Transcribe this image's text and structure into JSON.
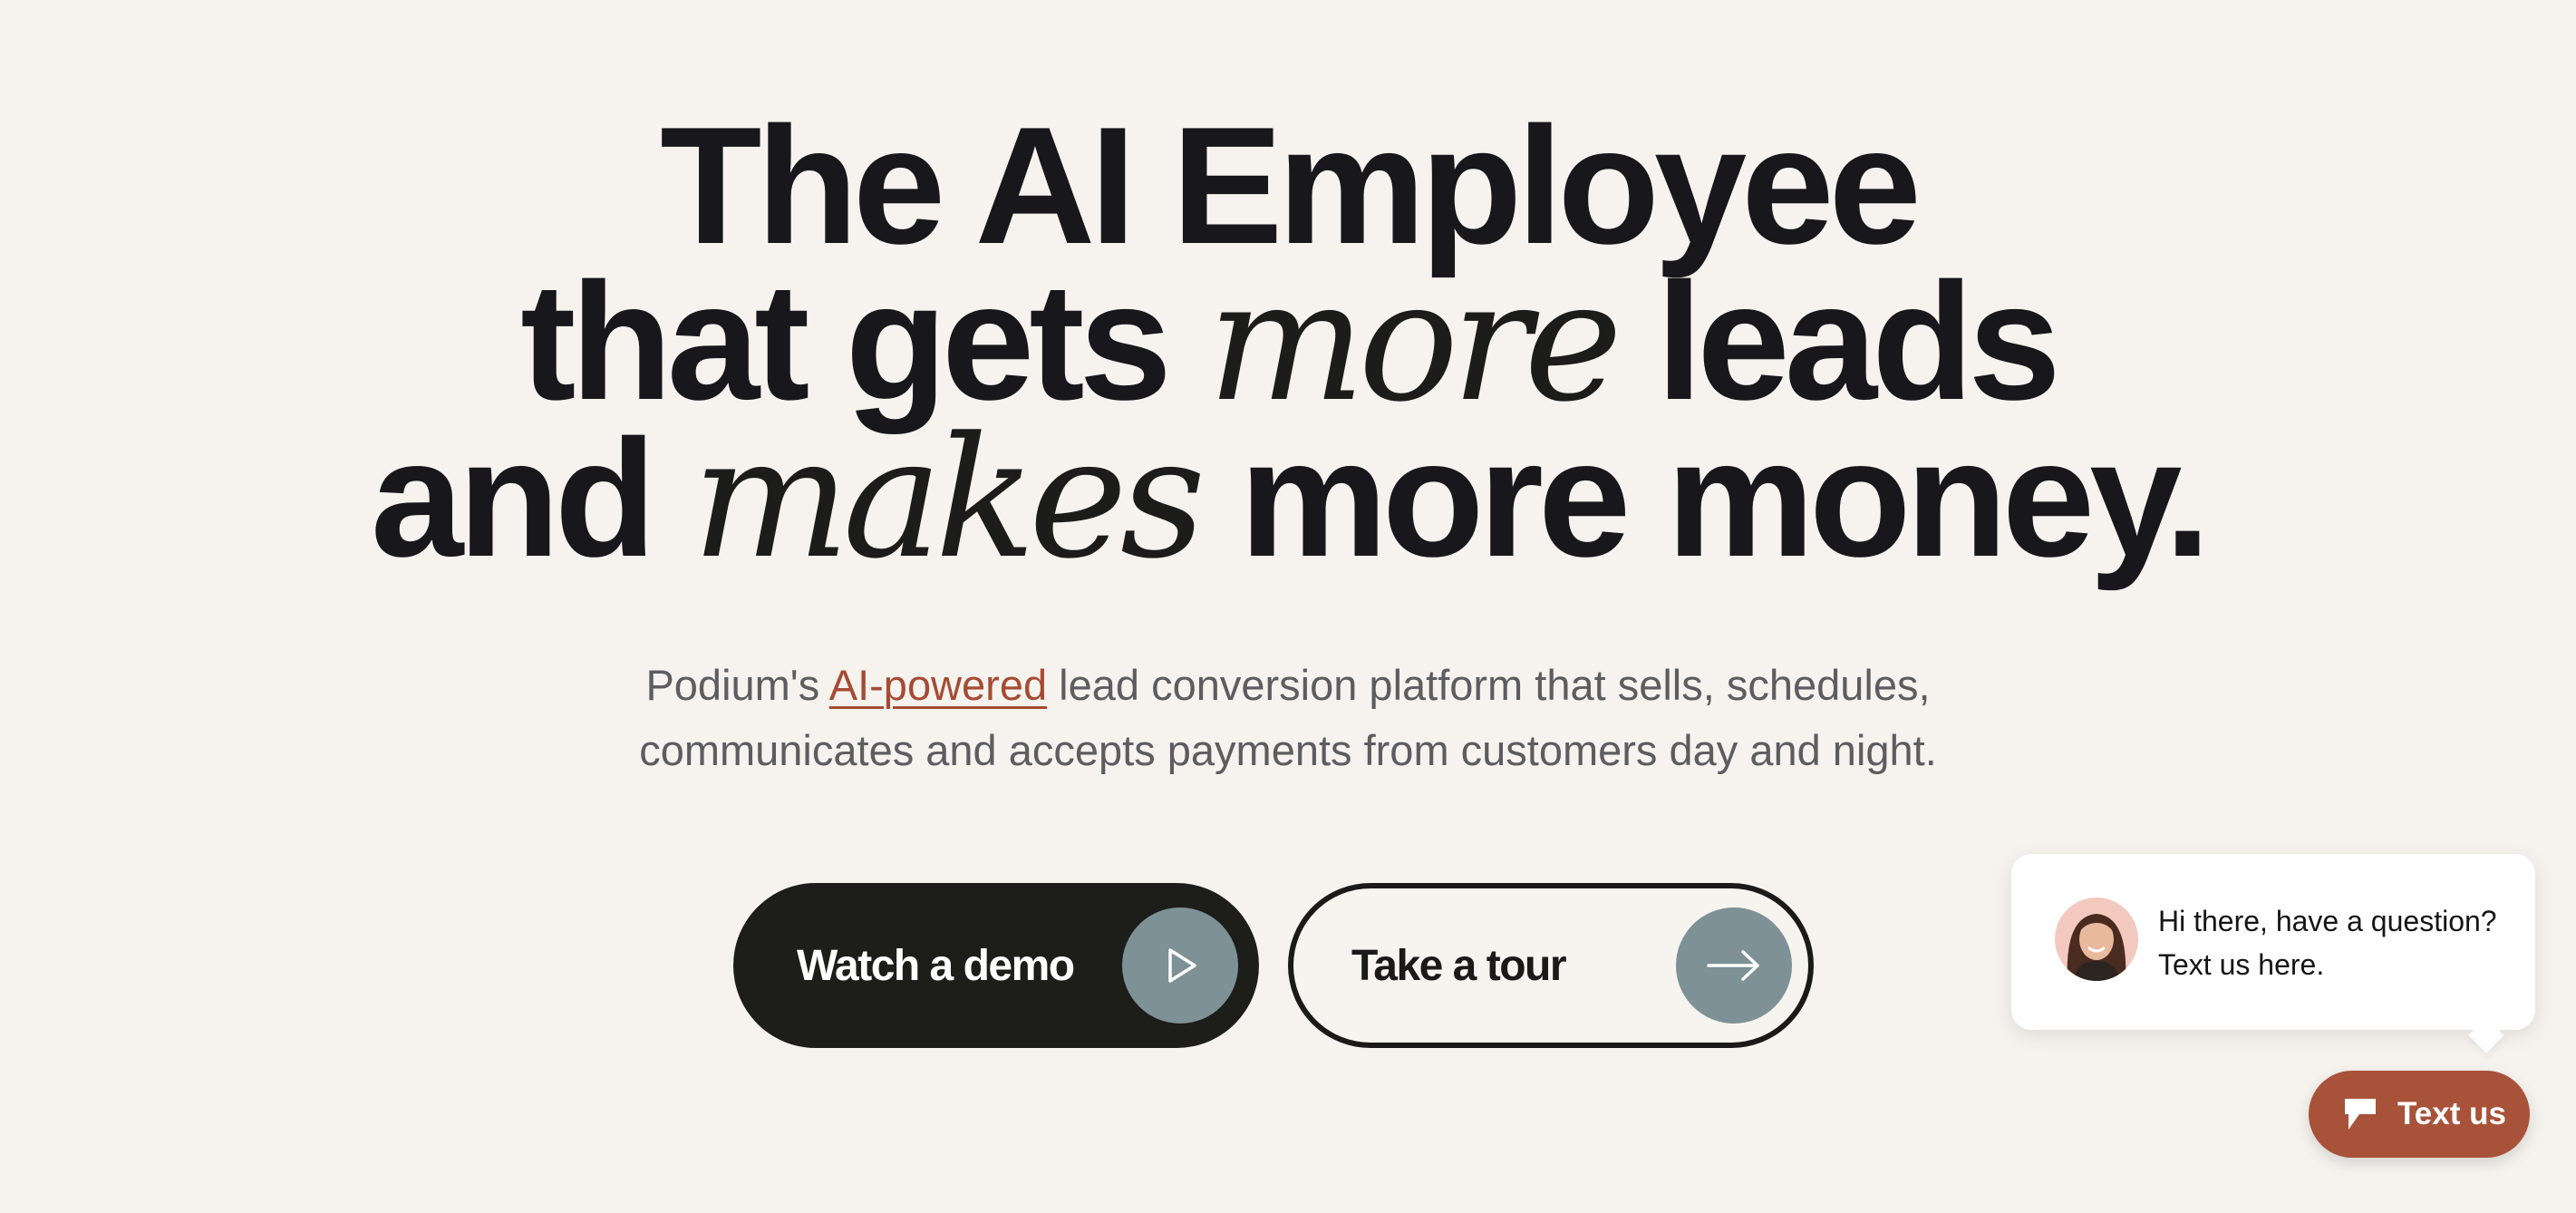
{
  "hero": {
    "line1": "The AI Employee",
    "line2_a": "that gets ",
    "line2_em": "more",
    "line2_b": " leads",
    "line3_a": "and ",
    "line3_em": "makes",
    "line3_b": " more money."
  },
  "subtitle": {
    "prefix": "Podium's ",
    "link": "AI-powered",
    "line1_rest": " lead conversion platform that sells, schedules,",
    "line2": "communicates and accepts payments from customers day and night."
  },
  "buttons": {
    "demo_label": "Watch a demo",
    "demo_icon": "play-icon",
    "tour_label": "Take a tour",
    "tour_icon": "arrow-right-icon"
  },
  "chat_widget": {
    "message": "Hi there, have a question? Text us here.",
    "avatar": "support-agent-avatar",
    "button_label": "Text us",
    "button_icon": "podium-chat-icon"
  },
  "colors": {
    "background": "#f6f3ef",
    "heading": "#17171c",
    "accent": "#a8523a",
    "button_dark": "#1d1d19",
    "icon_circle": "#7d9196"
  }
}
